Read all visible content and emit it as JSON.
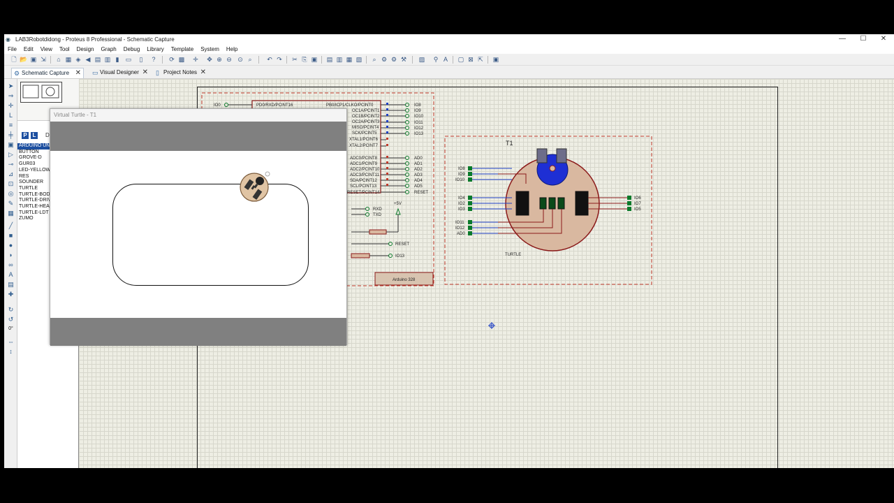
{
  "window": {
    "title": "LAB3Robotdidong - Proteus 8 Professional - Schematic Capture",
    "controls": [
      "—",
      "☐",
      "✕"
    ]
  },
  "menu": [
    "File",
    "Edit",
    "View",
    "Tool",
    "Design",
    "Graph",
    "Debug",
    "Library",
    "Template",
    "System",
    "Help"
  ],
  "tabs": [
    {
      "label": "Schematic Capture",
      "active": true
    },
    {
      "label": "Visual Designer",
      "active": false
    },
    {
      "label": "Project Notes",
      "active": false
    }
  ],
  "device_panel": {
    "buttons": [
      "P",
      "L",
      "D"
    ],
    "devices": [
      "ARDUINO UNO",
      "BUTTON",
      "GROVE-D",
      "GUR03",
      "LED-YELLOW",
      "RES",
      "SOUNDER",
      "TURTLE",
      "TURTLE-BODY",
      "TURTLE-DRIVE",
      "TURTLE-HEAD",
      "TURTLE-LDT",
      "ZUMO"
    ],
    "selected": "ARDUINO UNO"
  },
  "rotation": "0°",
  "virtual_turtle": {
    "title": "Virtual Turtle - T1"
  },
  "arduino": {
    "left_pin_top": "PD0/RXD/PCINT16",
    "left_net": "IO0",
    "right_pins_top": [
      "PB0/ICP1/CLKO/PCINT0",
      "OC1A/PCINT1",
      "OC1B/PCINT2",
      "OC2A/PCINT3",
      "MISO/PCINT4",
      "SCK/PCINT5",
      "XTAL1/PCINT6",
      "XTAL2/PCINT7"
    ],
    "right_nets_top": [
      "IO8",
      "IO9",
      "IO10",
      "IO11",
      "IO12",
      "IO13"
    ],
    "right_pins_bottom": [
      "ADC0/PCINT8",
      "ADC1/PCINT9",
      "ADC2/PCINT10",
      "ADC3/PCINT11",
      "SDA/PCINT12",
      "SCL/PCINT13",
      "RESET/PCINT14"
    ],
    "right_nets_bottom": [
      "AD0",
      "AD1",
      "AD2",
      "AD3",
      "AD4",
      "AD5",
      "RESET"
    ],
    "serial": [
      "RXD",
      "TXD"
    ],
    "supply": "+5V",
    "reset_net": "RESET",
    "io13_net": "IO13",
    "label": "Arduino 328"
  },
  "turtle": {
    "ref": "T1",
    "name": "TURTLE",
    "left_nets": [
      "IO8",
      "IO9",
      "IO10",
      "IO4",
      "IO2",
      "IO3",
      "IO11",
      "IO12",
      "AD0"
    ],
    "right_nets": [
      "IO6",
      "IO7",
      "IO5"
    ]
  }
}
